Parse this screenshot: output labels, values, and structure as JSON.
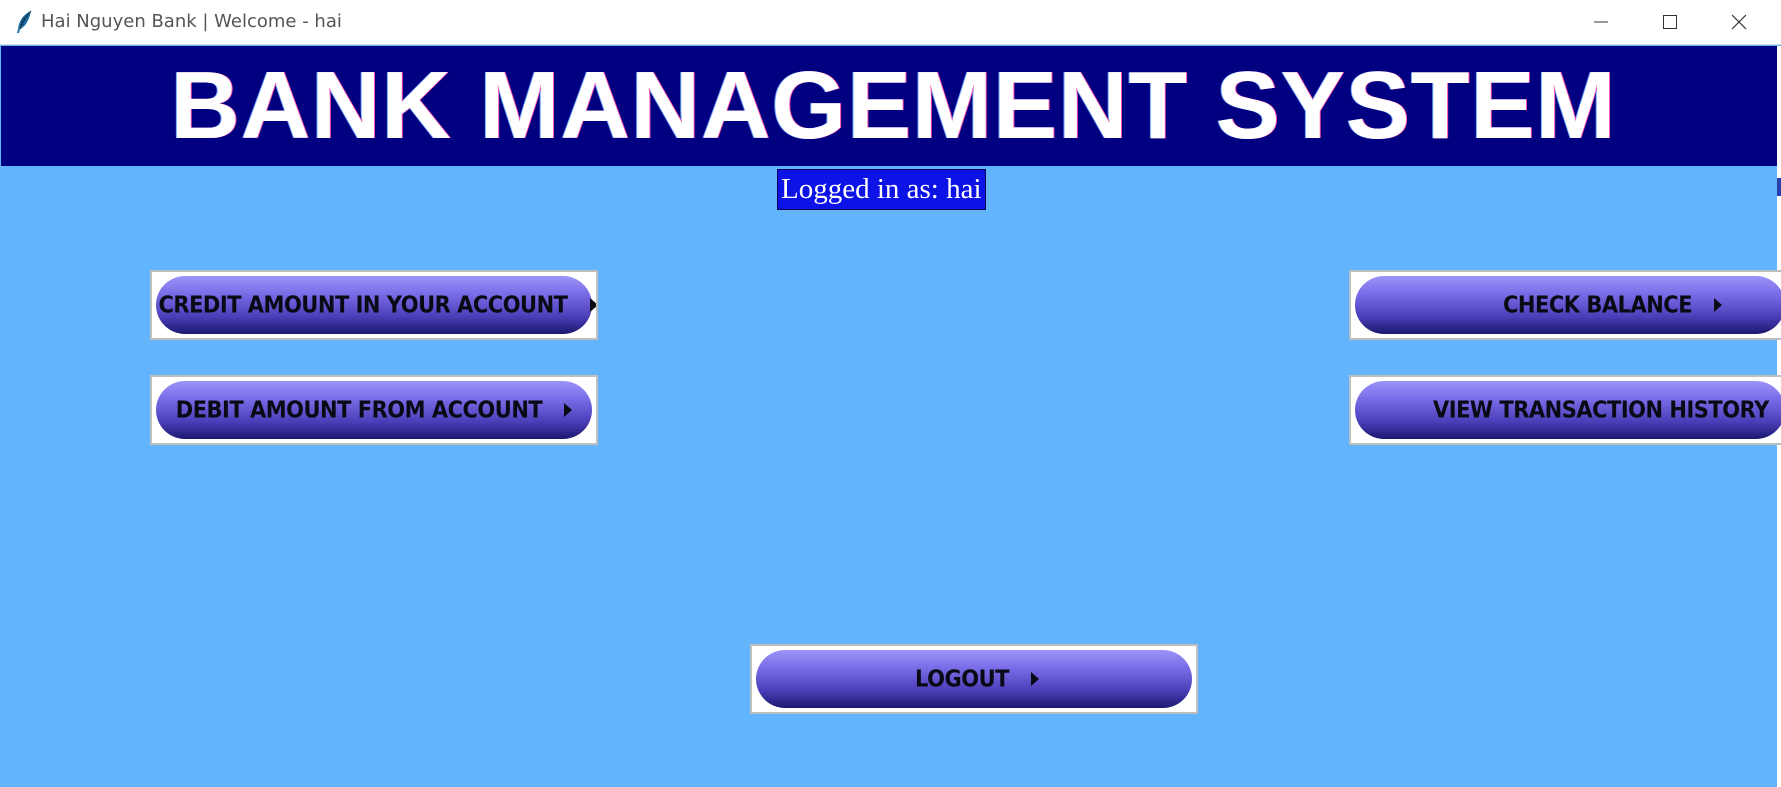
{
  "window": {
    "title": "Hai Nguyen Bank | Welcome - hai",
    "app_icon": "feather-icon",
    "controls": [
      "minimize-icon",
      "maximize-icon",
      "close-icon"
    ]
  },
  "header": {
    "title": "BANK MANAGEMENT SYSTEM",
    "background_color": "#000080",
    "text_color": "#ffffff"
  },
  "session": {
    "logged_in_label": "Logged in as: hai"
  },
  "actions": {
    "credit": "CREDIT AMOUNT IN YOUR ACCOUNT",
    "debit": "DEBIT AMOUNT FROM ACCOUNT",
    "balance": "CHECK BALANCE",
    "history": "VIEW TRANSACTION HISTORY",
    "logout": "LOGOUT"
  },
  "colors": {
    "background": "#62b4fc",
    "badge": "#0d13e6",
    "button_top": "#9c93f8",
    "button_bottom": "#1c1870"
  }
}
